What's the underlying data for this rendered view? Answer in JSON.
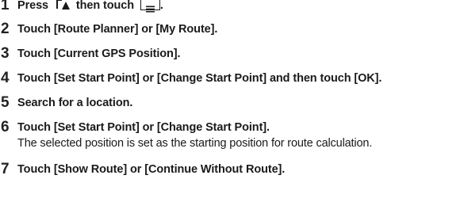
{
  "steps": [
    {
      "number": "1",
      "parts": [
        "Press",
        "then touch",
        "."
      ],
      "icons": [
        "home-button-icon",
        "menu-button-icon"
      ]
    },
    {
      "number": "2",
      "text": "Touch [Route Planner] or [My Route]."
    },
    {
      "number": "3",
      "text": "Touch [Current GPS Position]."
    },
    {
      "number": "4",
      "text": "Touch [Set Start Point] or [Change Start Point] and then touch [OK]."
    },
    {
      "number": "5",
      "text": "Search for a location."
    },
    {
      "number": "6",
      "text": "Touch [Set Start Point] or [Change Start Point].",
      "note": "The selected position is set as the starting position for route calculation."
    },
    {
      "number": "7",
      "text": "Touch [Show Route] or [Continue Without Route]."
    }
  ]
}
